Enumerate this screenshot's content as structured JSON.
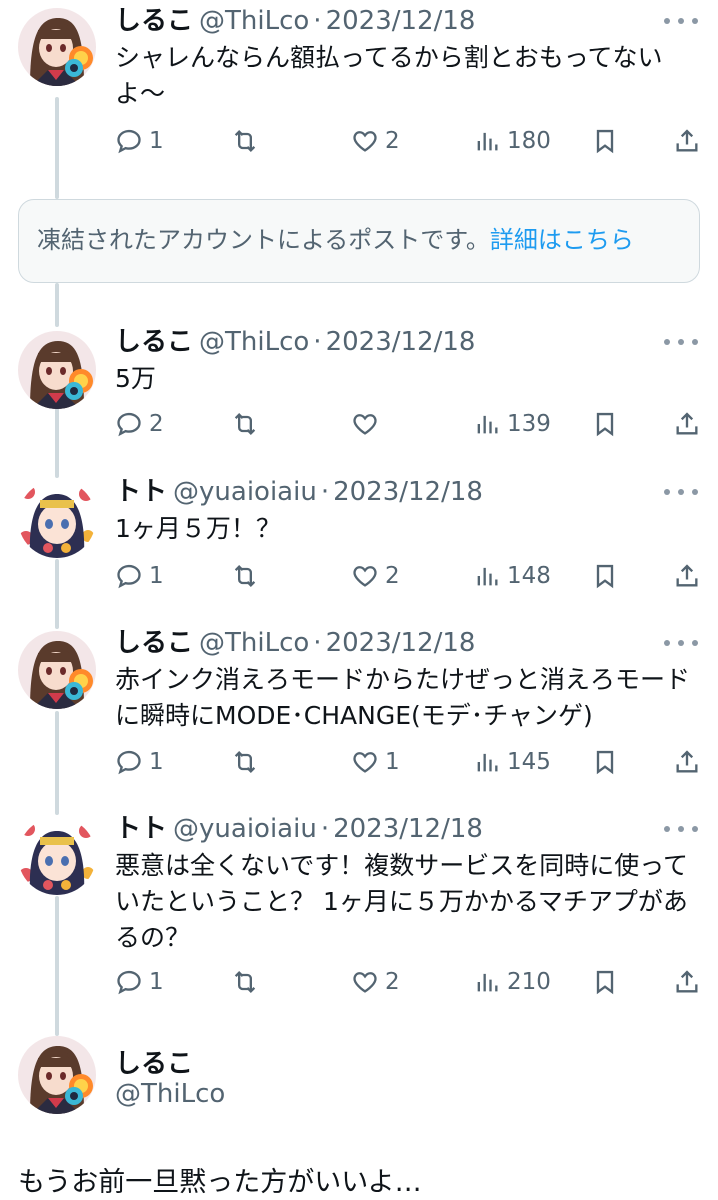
{
  "tweets": [
    {
      "name": "しるこ",
      "handle": "@ThiLco",
      "separator": "·",
      "date": "2023/12/18",
      "text": "シャレんならん額払ってるから割とおもってないよ〜",
      "counts": {
        "reply": "1",
        "retweet": "",
        "like": "2",
        "views": "180"
      },
      "avatar": "shiruko-avatar"
    },
    {
      "name": "しるこ",
      "handle": "@ThiLco",
      "separator": "·",
      "date": "2023/12/18",
      "text": "5万",
      "counts": {
        "reply": "2",
        "retweet": "",
        "like": "",
        "views": "139"
      },
      "avatar": "shiruko-avatar"
    },
    {
      "name": "トト",
      "handle": "@yuaioiaiu",
      "separator": "·",
      "date": "2023/12/18",
      "text": "1ヶ月５万！？",
      "counts": {
        "reply": "1",
        "retweet": "",
        "like": "2",
        "views": "148"
      },
      "avatar": "toto-avatar"
    },
    {
      "name": "しるこ",
      "handle": "@ThiLco",
      "separator": "·",
      "date": "2023/12/18",
      "text": "赤インク消えろモードからたけぜっと消えろモードに瞬時にMODE･CHANGE(モデ･チャンゲ)",
      "counts": {
        "reply": "1",
        "retweet": "",
        "like": "1",
        "views": "145"
      },
      "avatar": "shiruko-avatar"
    },
    {
      "name": "トト",
      "handle": "@yuaioiaiu",
      "separator": "·",
      "date": "2023/12/18",
      "text": "悪意は全くないです！複数サービスを同時に使っていたということ？ 1ヶ月に５万かかるマチアプがあるの？",
      "counts": {
        "reply": "1",
        "retweet": "",
        "like": "2",
        "views": "210"
      },
      "avatar": "toto-avatar"
    }
  ],
  "frozen_notice": {
    "text": "凍結されたアカウントによるポストです。",
    "link": "詳細はこちら"
  },
  "main_tweet": {
    "name": "しるこ",
    "handle": "@ThiLco",
    "text": "もうお前一旦黙った方がいいよ…"
  },
  "colors": {
    "text": "#0f1419",
    "secondary": "#536471",
    "link": "#1d9bf0",
    "thread_line": "#cfd9de",
    "notice_bg": "#f7f9f9"
  },
  "icons": [
    "reply-icon",
    "retweet-icon",
    "like-icon",
    "views-icon",
    "bookmark-icon",
    "share-icon",
    "more-icon"
  ]
}
